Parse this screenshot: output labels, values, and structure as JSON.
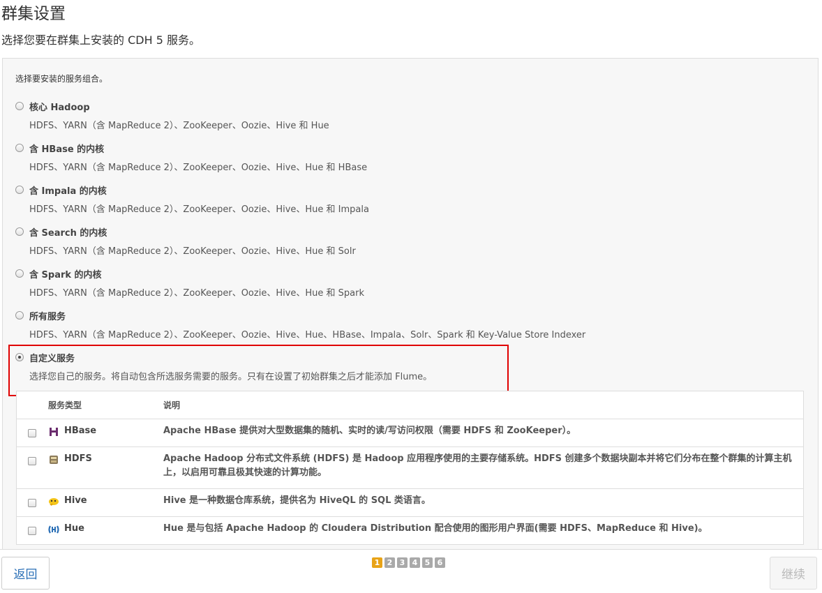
{
  "page": {
    "title": "群集设置",
    "subtitle": "选择您要在群集上安装的 CDH 5 服务。"
  },
  "panel": {
    "prompt": "选择要安装的服务组合。",
    "options": [
      {
        "title": "核心 Hadoop",
        "desc": "HDFS、YARN（含 MapReduce 2）、ZooKeeper、Oozie、Hive 和 Hue",
        "checked": false
      },
      {
        "title": "含 HBase 的内核",
        "desc": "HDFS、YARN（含 MapReduce 2）、ZooKeeper、Oozie、Hive、Hue 和 HBase",
        "checked": false
      },
      {
        "title": "含 Impala 的内核",
        "desc": "HDFS、YARN（含 MapReduce 2）、ZooKeeper、Oozie、Hive、Hue 和 Impala",
        "checked": false
      },
      {
        "title": "含 Search 的内核",
        "desc": "HDFS、YARN（含 MapReduce 2）、ZooKeeper、Oozie、Hive、Hue 和 Solr",
        "checked": false
      },
      {
        "title": "含 Spark 的内核",
        "desc": "HDFS、YARN（含 MapReduce 2）、ZooKeeper、Oozie、Hive、Hue 和 Spark",
        "checked": false
      },
      {
        "title": "所有服务",
        "desc": "HDFS、YARN（含 MapReduce 2）、ZooKeeper、Oozie、Hive、Hue、HBase、Impala、Solr、Spark 和 Key-Value Store Indexer",
        "checked": false
      },
      {
        "title": "自定义服务",
        "desc": "选择您自己的服务。将自动包含所选服务需要的服务。只有在设置了初始群集之后才能添加 Flume。",
        "checked": true
      }
    ]
  },
  "services": {
    "columns": {
      "type": "服务类型",
      "description": "说明"
    },
    "rows": [
      {
        "name": "HBase",
        "icon": "hbase-icon",
        "desc": "Apache HBase 提供对大型数据集的随机、实时的读/写访问权限（需要 HDFS 和 ZooKeeper）。"
      },
      {
        "name": "HDFS",
        "icon": "hdfs-icon",
        "desc": "Apache Hadoop 分布式文件系统 (HDFS) 是 Hadoop 应用程序使用的主要存储系统。HDFS 创建多个数据块副本并将它们分布在整个群集的计算主机上，以启用可靠且极其快速的计算功能。"
      },
      {
        "name": "Hive",
        "icon": "hive-icon",
        "desc": "Hive 是一种数据仓库系统，提供名为 HiveQL 的 SQL 类语言。"
      },
      {
        "name": "Hue",
        "icon": "hue-icon",
        "desc": "Hue 是与包括 Apache Hadoop 的 Cloudera Distribution 配合使用的图形用户界面(需要 HDFS、MapReduce 和 Hive)。"
      }
    ]
  },
  "footer": {
    "back_label": "返回",
    "next_label": "继续",
    "pages": [
      "1",
      "2",
      "3",
      "4",
      "5",
      "6"
    ],
    "current_page": "1"
  },
  "colors": {
    "accent_page": "#e8a317",
    "link": "#2a6fb6",
    "highlight": "#e00000"
  }
}
